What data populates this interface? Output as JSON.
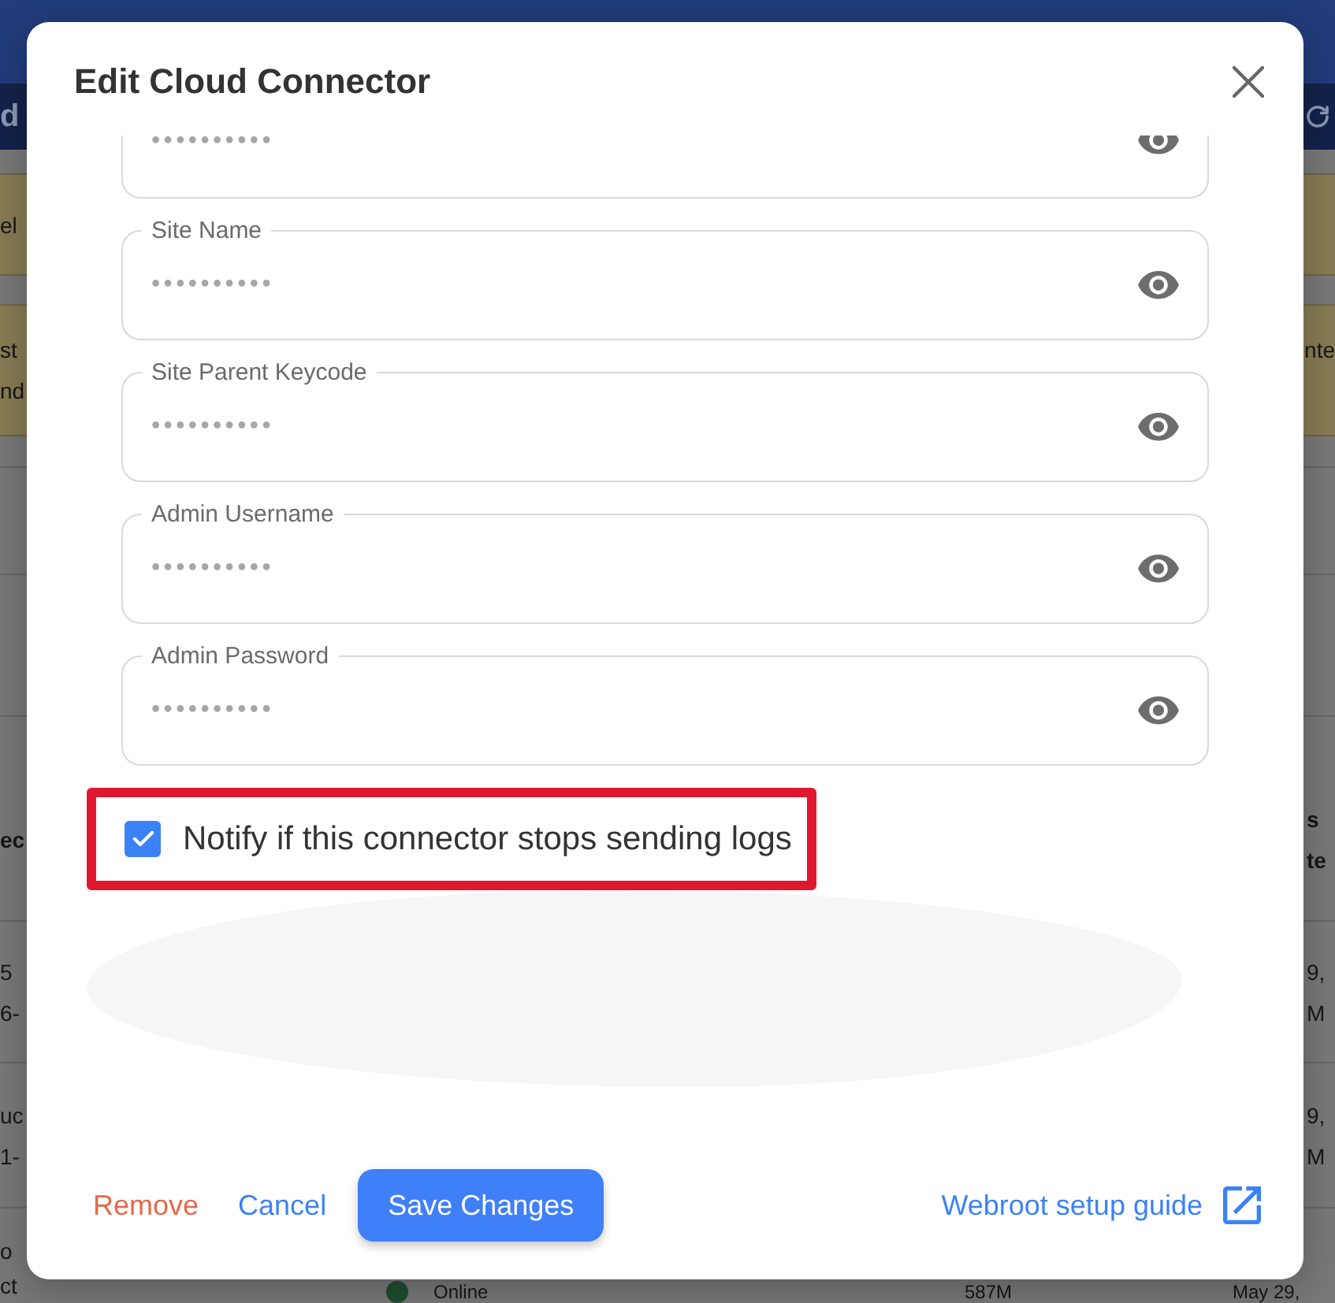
{
  "page": {
    "toolbar": {
      "title": "d"
    },
    "banners": [
      {
        "left_lines": [
          "el"
        ]
      },
      {
        "left_lines": [
          "st",
          "nd"
        ],
        "right_text": "nte"
      }
    ],
    "table": {
      "header": {
        "column_1": "ec",
        "column_5": [
          "s",
          "te"
        ]
      },
      "rows": [
        {
          "column_1": [
            "5",
            "6-"
          ],
          "column_5": [
            "9,",
            "M"
          ]
        },
        {
          "column_1": [
            "uc",
            "1-"
          ],
          "column_5": [
            "9,",
            "M"
          ]
        },
        {
          "column_1": [
            "o",
            "ct"
          ],
          "status": {
            "label": "Online",
            "color": "#1e4e30"
          },
          "column_4": "587M",
          "column_5": [
            "May 29,"
          ]
        }
      ]
    }
  },
  "dialog": {
    "title": "Edit Cloud Connector",
    "partial_field": {
      "value": "••••••••••"
    },
    "fields": [
      {
        "label": "Site Name",
        "value": "••••••••••"
      },
      {
        "label": "Site Parent Keycode",
        "value": "••••••••••"
      },
      {
        "label": "Admin Username",
        "value": "••••••••••"
      },
      {
        "label": "Admin Password",
        "value": "••••••••••"
      }
    ],
    "notify": {
      "label": "Notify if this connector stops sending logs",
      "checked": true
    },
    "buttons": [
      {
        "kind": "danger",
        "label": "Remove"
      },
      {
        "kind": "link",
        "label": "Cancel"
      },
      {
        "kind": "primary",
        "label": "Save Changes"
      }
    ],
    "setup_link": {
      "label": "Webroot setup guide"
    }
  }
}
